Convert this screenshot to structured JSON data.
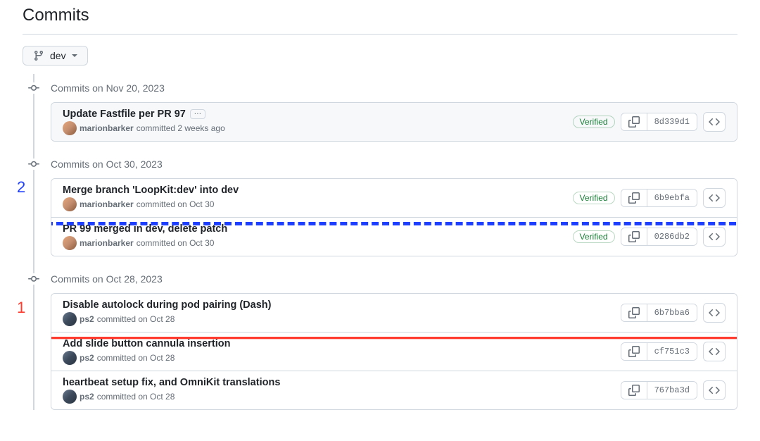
{
  "header": {
    "title": "Commits"
  },
  "branch": {
    "name": "dev"
  },
  "groups": [
    {
      "date_label": "Commits on Nov 20, 2023",
      "commits": [
        {
          "title": "Update Fastfile per PR 97",
          "author": "marionbarker",
          "meta": "committed 2 weeks ago",
          "verified": "Verified",
          "sha": "8d339d1",
          "ellipsis": true,
          "avatar": "m"
        }
      ]
    },
    {
      "date_label": "Commits on Oct 30, 2023",
      "commits": [
        {
          "title": "Merge branch 'LoopKit:dev' into dev",
          "author": "marionbarker",
          "meta": "committed on Oct 30",
          "verified": "Verified",
          "sha": "6b9ebfa",
          "avatar": "m"
        },
        {
          "title": "PR 99 merged in dev, delete patch",
          "author": "marionbarker",
          "meta": "committed on Oct 30",
          "verified": "Verified",
          "sha": "0286db2",
          "avatar": "m"
        }
      ]
    },
    {
      "date_label": "Commits on Oct 28, 2023",
      "commits": [
        {
          "title": "Disable autolock during pod pairing (Dash)",
          "author": "ps2",
          "meta": "committed on Oct 28",
          "sha": "6b7bba6",
          "avatar": "p"
        },
        {
          "title": "Add slide button cannula insertion",
          "author": "ps2",
          "meta": "committed on Oct 28",
          "sha": "cf751c3",
          "avatar": "p"
        },
        {
          "title": "heartbeat setup fix, and OmniKit translations",
          "author": "ps2",
          "meta": "committed on Oct 28",
          "sha": "767ba3d",
          "avatar": "p"
        }
      ]
    }
  ],
  "annotations": {
    "label1": "1",
    "label2": "2"
  }
}
